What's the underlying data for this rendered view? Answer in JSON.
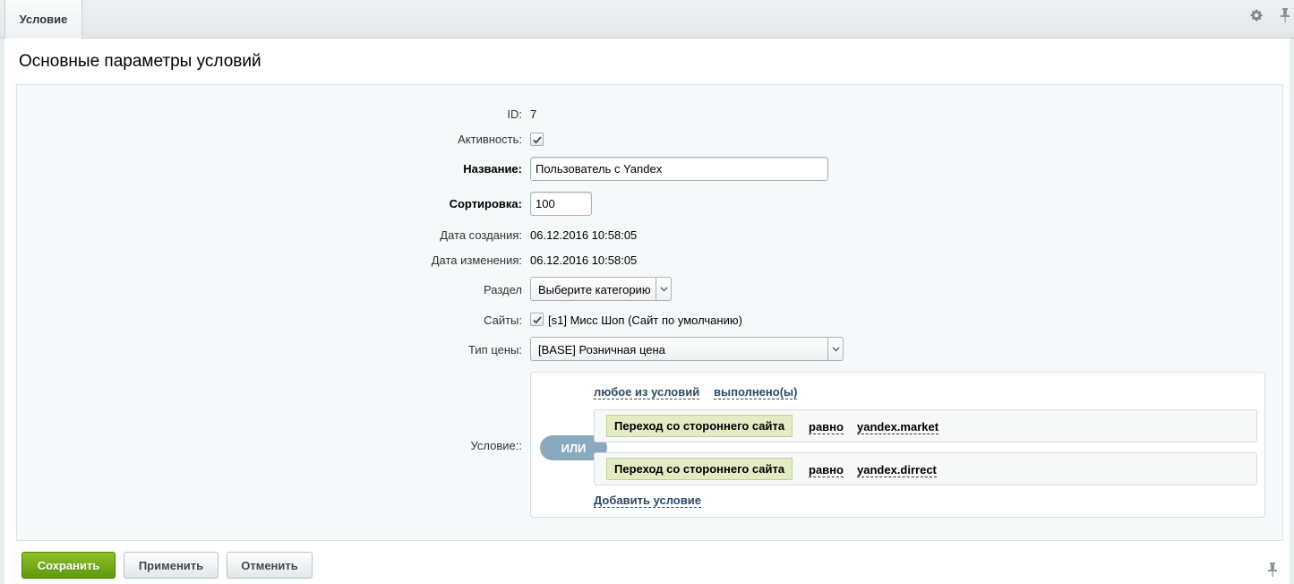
{
  "tabs": [
    {
      "label": "Условие"
    }
  ],
  "section_title": "Основные параметры условий",
  "fields": {
    "id": {
      "label": "ID:",
      "value": "7"
    },
    "active": {
      "label": "Активность:",
      "checked": true
    },
    "name": {
      "label": "Название:",
      "value": "Пользователь с Yandex"
    },
    "sort": {
      "label": "Сортировка:",
      "value": "100"
    },
    "created": {
      "label": "Дата создания:",
      "value": "06.12.2016 10:58:05"
    },
    "modified": {
      "label": "Дата изменения:",
      "value": "06.12.2016 10:58:05"
    },
    "section": {
      "label": "Раздел",
      "selected": "Выберите категорию"
    },
    "sites": {
      "label": "Сайты:",
      "checked": true,
      "site_label": "[s1] Мисс Шоп (Сайт по умолчанию)"
    },
    "price_type": {
      "label": "Тип цены:",
      "selected": "[BASE] Розничная цена"
    },
    "condition": {
      "label": "Условие::",
      "any_label": "любое из условий",
      "done_label": "выполнено(ы)",
      "logic": "ИЛИ",
      "rules": [
        {
          "name": "Переход со стороннего сайта",
          "op": "равно",
          "value": "yandex.market"
        },
        {
          "name": "Переход со стороннего сайта",
          "op": "равно",
          "value": "yandex.dirrect"
        }
      ],
      "add_label": "Добавить условие"
    }
  },
  "buttons": {
    "save": "Сохранить",
    "apply": "Применить",
    "cancel": "Отменить"
  },
  "colors": {
    "save_button": "#6ea81a",
    "condition_chip": "#e3ebc3",
    "or_pill": "#8aa8be",
    "link": "#2c4a63"
  },
  "icons": [
    "gear-icon",
    "pin-icon",
    "checkmark-icon",
    "chevron-down-icon"
  ]
}
